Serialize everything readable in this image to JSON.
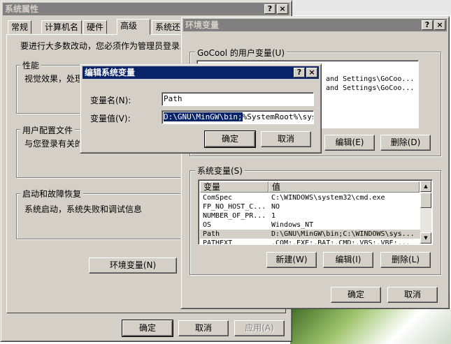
{
  "system_properties": {
    "title": "系统属性",
    "tabs": [
      "常规",
      "计算机名",
      "硬件",
      "高级",
      "系统还"
    ],
    "intro": "要进行大多数改动，您必须作为管理员登录。",
    "performance": {
      "label": "性能",
      "text": "视觉效果，处理"
    },
    "user_profile": {
      "label": "用户配置文件",
      "text": "与您登录有关的"
    },
    "startup": {
      "label": "启动和故障恢复",
      "text": "系统启动，系统失败和调试信息"
    },
    "env_button": "环境变量(N)",
    "ok": "确定",
    "cancel": "取消",
    "apply": "应用(A)"
  },
  "env_vars": {
    "title": "环境变量",
    "user_group": "GoCool 的用户变量(U)",
    "user_rows": [
      "and Settings\\GoCoo...",
      "and Settings\\GoCoo..."
    ],
    "edit": "编辑(E)",
    "delete": "删除(D)",
    "sys_group": "系统变量(S)",
    "col_var": "变量",
    "col_val": "值",
    "sys_rows": [
      {
        "name": "ComSpec",
        "value": "C:\\WINDOWS\\system32\\cmd.exe"
      },
      {
        "name": "FP_NO_HOST_C...",
        "value": "NO"
      },
      {
        "name": "NUMBER_OF_PR...",
        "value": "1"
      },
      {
        "name": "OS",
        "value": "Windows_NT"
      },
      {
        "name": "Path",
        "value": "D:\\GNU\\MinGW\\bin;C:\\WINDOWS\\sys..."
      },
      {
        "name": "PATHEXT",
        "value": ".COM;.EXE;.BAT;.CMD;.VBS;.VBE;..."
      }
    ],
    "new": "新建(W)",
    "edit2": "编辑(I)",
    "delete2": "删除(L)",
    "ok": "确定",
    "cancel": "取消"
  },
  "edit_dialog": {
    "title": "编辑系统变量",
    "name_label": "变量名(N):",
    "name_value": "Path",
    "value_label": "变量值(V):",
    "value_selected": "D:\\GNU\\MinGW\\bin;",
    "value_rest": "%SystemRoot%\\system",
    "ok": "确定",
    "cancel": "取消"
  },
  "title_buttons": {
    "help": "?",
    "close": "×"
  },
  "scroll": {
    "up": "▲",
    "down": "▼"
  }
}
